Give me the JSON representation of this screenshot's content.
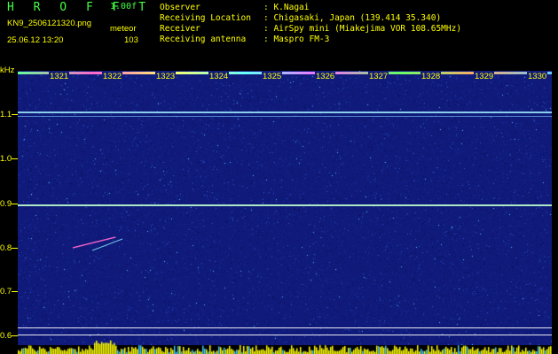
{
  "header": {
    "logo": "H R O F F T",
    "version": "1.00f",
    "filename": "KN9_2506121320.png",
    "datetime": "25.06.12 13:20",
    "meteor_label": "meteor",
    "meteor_count": "103",
    "info": [
      {
        "label": "Observer",
        "value": ": K.Nagai"
      },
      {
        "label": "Receiving Location",
        "value": ": Chigasaki, Japan (139.414 35.340)"
      },
      {
        "label": "Receiver",
        "value": ": AirSpy mini (Miakejima VOR 108.65MHz)"
      },
      {
        "label": "Receiving antenna",
        "value": ": Maspro FM-3"
      }
    ]
  },
  "spectrogram": {
    "y_unit": "kHz",
    "y_ticks": [
      "1.1",
      "1.0",
      "0.9",
      "0.8",
      "0.7",
      "0.6"
    ],
    "x_ticks": [
      "1321",
      "1322",
      "1323",
      "1324",
      "1325",
      "1326",
      "1327",
      "1328",
      "1329",
      "1330"
    ],
    "colors": {
      "background": "#101a7a",
      "axis_text": "#ffff00",
      "signal_line": "#9ff0ff",
      "bottom_line": "#ffffff"
    }
  }
}
